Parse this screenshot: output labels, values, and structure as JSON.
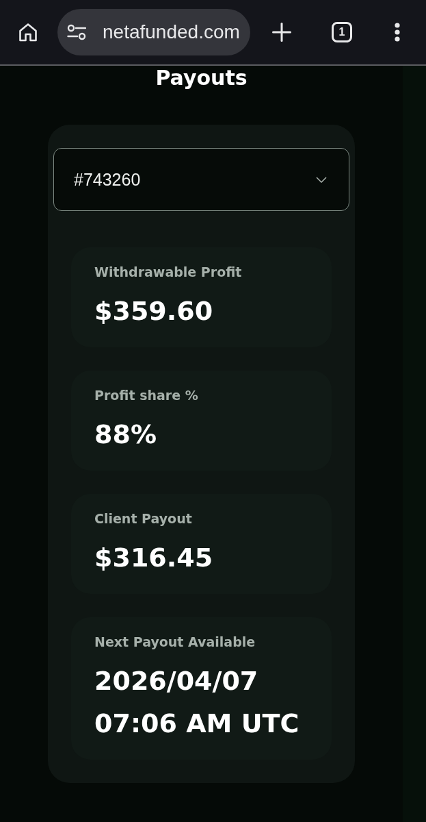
{
  "browser": {
    "url": "netafunded.com",
    "tab_count": "1"
  },
  "page": {
    "title": "Payouts"
  },
  "account_select": {
    "value": "#743260"
  },
  "stats": [
    {
      "label": "Withdrawable Profit",
      "value": "$359.60"
    },
    {
      "label": "Profit share %",
      "value": "88%"
    },
    {
      "label": "Client Payout",
      "value": "$316.45"
    },
    {
      "label": "Next Payout Available",
      "value": "2026/04/07 07:06 AM UTC"
    }
  ]
}
